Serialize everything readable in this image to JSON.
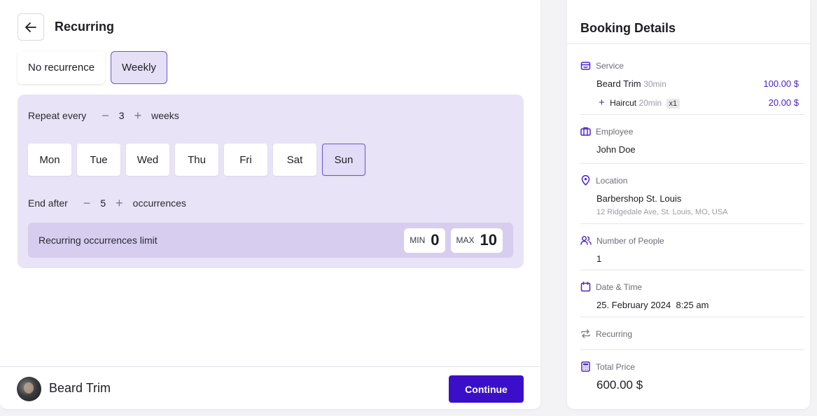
{
  "header": {
    "title": "Recurring"
  },
  "modes": [
    {
      "label": "No recurrence",
      "active": false
    },
    {
      "label": "Weekly",
      "active": true
    }
  ],
  "repeat": {
    "label": "Repeat every",
    "value": "3",
    "unit": "weeks"
  },
  "days": [
    {
      "label": "Mon",
      "active": false
    },
    {
      "label": "Tue",
      "active": false
    },
    {
      "label": "Wed",
      "active": false
    },
    {
      "label": "Thu",
      "active": false
    },
    {
      "label": "Fri",
      "active": false
    },
    {
      "label": "Sat",
      "active": false
    },
    {
      "label": "Sun",
      "active": true
    }
  ],
  "end_after": {
    "label": "End after",
    "value": "5",
    "unit": "occurrences"
  },
  "limit": {
    "label": "Recurring occurrences limit",
    "min_label": "MIN",
    "min_value": "0",
    "max_label": "MAX",
    "max_value": "10"
  },
  "footer": {
    "service": "Beard Trim",
    "continue_label": "Continue"
  },
  "booking": {
    "title": "Booking Details",
    "service": {
      "label": "Service",
      "main_name": "Beard Trim",
      "main_duration": "30min",
      "main_price": "100.00 $",
      "extra_name": "Haircut",
      "extra_duration": "20min",
      "extra_qty": "x1",
      "extra_price": "20.00 $"
    },
    "employee": {
      "label": "Employee",
      "value": "John Doe"
    },
    "location": {
      "label": "Location",
      "name": "Barbershop St. Louis",
      "address": "12 Ridgedale Ave, St. Louis, MO, USA"
    },
    "people": {
      "label": "Number of People",
      "value": "1"
    },
    "datetime": {
      "label": "Date & Time",
      "value": "25. February 2024  8:25 am"
    },
    "recurring": {
      "label": "Recurring"
    },
    "total": {
      "label": "Total Price",
      "value": "600.00 $"
    }
  },
  "colors": {
    "accent": "#3b0fc9",
    "accent_light": "#e8e3f6",
    "price": "#4b22c8"
  },
  "icons": [
    "arrow-left-icon",
    "plus-icon",
    "minus-icon",
    "basket-icon",
    "briefcase-icon",
    "map-pin-icon",
    "people-icon",
    "calendar-icon",
    "repeat-icon",
    "calculator-icon"
  ]
}
